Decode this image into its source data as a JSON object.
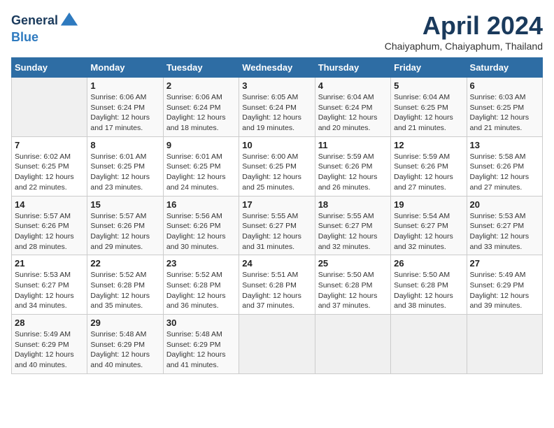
{
  "header": {
    "logo_line1": "General",
    "logo_line2": "Blue",
    "month_title": "April 2024",
    "location": "Chaiyaphum, Chaiyaphum, Thailand"
  },
  "days_of_week": [
    "Sunday",
    "Monday",
    "Tuesday",
    "Wednesday",
    "Thursday",
    "Friday",
    "Saturday"
  ],
  "weeks": [
    [
      {
        "day": "",
        "info": ""
      },
      {
        "day": "1",
        "info": "Sunrise: 6:06 AM\nSunset: 6:24 PM\nDaylight: 12 hours\nand 17 minutes."
      },
      {
        "day": "2",
        "info": "Sunrise: 6:06 AM\nSunset: 6:24 PM\nDaylight: 12 hours\nand 18 minutes."
      },
      {
        "day": "3",
        "info": "Sunrise: 6:05 AM\nSunset: 6:24 PM\nDaylight: 12 hours\nand 19 minutes."
      },
      {
        "day": "4",
        "info": "Sunrise: 6:04 AM\nSunset: 6:24 PM\nDaylight: 12 hours\nand 20 minutes."
      },
      {
        "day": "5",
        "info": "Sunrise: 6:04 AM\nSunset: 6:25 PM\nDaylight: 12 hours\nand 21 minutes."
      },
      {
        "day": "6",
        "info": "Sunrise: 6:03 AM\nSunset: 6:25 PM\nDaylight: 12 hours\nand 21 minutes."
      }
    ],
    [
      {
        "day": "7",
        "info": "Sunrise: 6:02 AM\nSunset: 6:25 PM\nDaylight: 12 hours\nand 22 minutes."
      },
      {
        "day": "8",
        "info": "Sunrise: 6:01 AM\nSunset: 6:25 PM\nDaylight: 12 hours\nand 23 minutes."
      },
      {
        "day": "9",
        "info": "Sunrise: 6:01 AM\nSunset: 6:25 PM\nDaylight: 12 hours\nand 24 minutes."
      },
      {
        "day": "10",
        "info": "Sunrise: 6:00 AM\nSunset: 6:25 PM\nDaylight: 12 hours\nand 25 minutes."
      },
      {
        "day": "11",
        "info": "Sunrise: 5:59 AM\nSunset: 6:26 PM\nDaylight: 12 hours\nand 26 minutes."
      },
      {
        "day": "12",
        "info": "Sunrise: 5:59 AM\nSunset: 6:26 PM\nDaylight: 12 hours\nand 27 minutes."
      },
      {
        "day": "13",
        "info": "Sunrise: 5:58 AM\nSunset: 6:26 PM\nDaylight: 12 hours\nand 27 minutes."
      }
    ],
    [
      {
        "day": "14",
        "info": "Sunrise: 5:57 AM\nSunset: 6:26 PM\nDaylight: 12 hours\nand 28 minutes."
      },
      {
        "day": "15",
        "info": "Sunrise: 5:57 AM\nSunset: 6:26 PM\nDaylight: 12 hours\nand 29 minutes."
      },
      {
        "day": "16",
        "info": "Sunrise: 5:56 AM\nSunset: 6:26 PM\nDaylight: 12 hours\nand 30 minutes."
      },
      {
        "day": "17",
        "info": "Sunrise: 5:55 AM\nSunset: 6:27 PM\nDaylight: 12 hours\nand 31 minutes."
      },
      {
        "day": "18",
        "info": "Sunrise: 5:55 AM\nSunset: 6:27 PM\nDaylight: 12 hours\nand 32 minutes."
      },
      {
        "day": "19",
        "info": "Sunrise: 5:54 AM\nSunset: 6:27 PM\nDaylight: 12 hours\nand 32 minutes."
      },
      {
        "day": "20",
        "info": "Sunrise: 5:53 AM\nSunset: 6:27 PM\nDaylight: 12 hours\nand 33 minutes."
      }
    ],
    [
      {
        "day": "21",
        "info": "Sunrise: 5:53 AM\nSunset: 6:27 PM\nDaylight: 12 hours\nand 34 minutes."
      },
      {
        "day": "22",
        "info": "Sunrise: 5:52 AM\nSunset: 6:28 PM\nDaylight: 12 hours\nand 35 minutes."
      },
      {
        "day": "23",
        "info": "Sunrise: 5:52 AM\nSunset: 6:28 PM\nDaylight: 12 hours\nand 36 minutes."
      },
      {
        "day": "24",
        "info": "Sunrise: 5:51 AM\nSunset: 6:28 PM\nDaylight: 12 hours\nand 37 minutes."
      },
      {
        "day": "25",
        "info": "Sunrise: 5:50 AM\nSunset: 6:28 PM\nDaylight: 12 hours\nand 37 minutes."
      },
      {
        "day": "26",
        "info": "Sunrise: 5:50 AM\nSunset: 6:28 PM\nDaylight: 12 hours\nand 38 minutes."
      },
      {
        "day": "27",
        "info": "Sunrise: 5:49 AM\nSunset: 6:29 PM\nDaylight: 12 hours\nand 39 minutes."
      }
    ],
    [
      {
        "day": "28",
        "info": "Sunrise: 5:49 AM\nSunset: 6:29 PM\nDaylight: 12 hours\nand 40 minutes."
      },
      {
        "day": "29",
        "info": "Sunrise: 5:48 AM\nSunset: 6:29 PM\nDaylight: 12 hours\nand 40 minutes."
      },
      {
        "day": "30",
        "info": "Sunrise: 5:48 AM\nSunset: 6:29 PM\nDaylight: 12 hours\nand 41 minutes."
      },
      {
        "day": "",
        "info": ""
      },
      {
        "day": "",
        "info": ""
      },
      {
        "day": "",
        "info": ""
      },
      {
        "day": "",
        "info": ""
      }
    ]
  ]
}
